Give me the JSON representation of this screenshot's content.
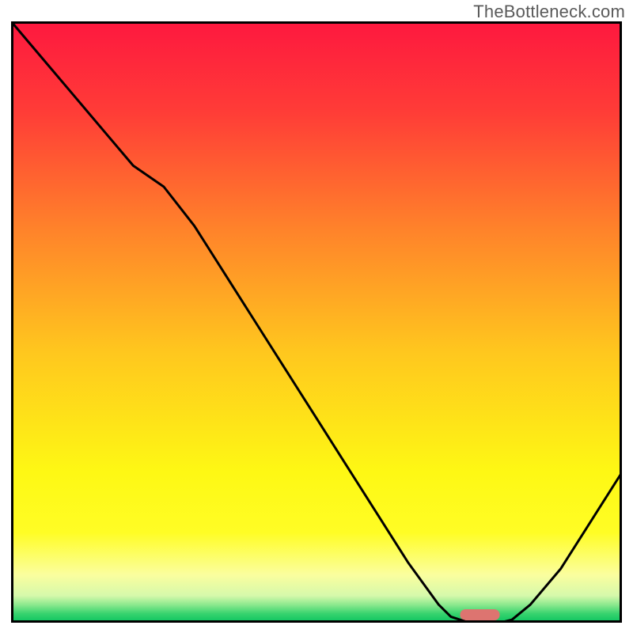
{
  "watermark": "TheBottleneck.com",
  "chart_data": {
    "type": "line",
    "title": "",
    "xlabel": "",
    "ylabel": "",
    "xlim": [
      0,
      100
    ],
    "ylim": [
      0,
      100
    ],
    "grid": false,
    "series": [
      {
        "name": "bottleneck-curve",
        "x": [
          0,
          5,
          10,
          15,
          20,
          25,
          30,
          35,
          40,
          45,
          50,
          55,
          60,
          65,
          70,
          72,
          75,
          78,
          80,
          82,
          85,
          90,
          95,
          100
        ],
        "y": [
          100,
          94,
          88,
          82,
          76,
          72.5,
          66,
          58,
          50,
          42,
          34,
          26,
          18,
          10,
          3,
          1,
          0,
          0,
          0,
          0.5,
          3,
          9,
          17,
          25
        ]
      }
    ],
    "marker": {
      "name": "selected-range-marker",
      "x_start": 73.5,
      "x_end": 80,
      "y": 0,
      "color": "#dd7470"
    },
    "background_gradient_stops": [
      {
        "offset": 0.0,
        "color": "#fe183f"
      },
      {
        "offset": 0.15,
        "color": "#ff3c37"
      },
      {
        "offset": 0.35,
        "color": "#ff842a"
      },
      {
        "offset": 0.55,
        "color": "#ffc71e"
      },
      {
        "offset": 0.75,
        "color": "#fef814"
      },
      {
        "offset": 0.85,
        "color": "#fffd25"
      },
      {
        "offset": 0.92,
        "color": "#fbfe9e"
      },
      {
        "offset": 0.955,
        "color": "#d6f9ab"
      },
      {
        "offset": 0.97,
        "color": "#8ce98e"
      },
      {
        "offset": 0.985,
        "color": "#37d36e"
      },
      {
        "offset": 1.0,
        "color": "#0bc45f"
      }
    ],
    "frame_color": "#000000",
    "line_color": "#000000",
    "line_width": 3
  }
}
